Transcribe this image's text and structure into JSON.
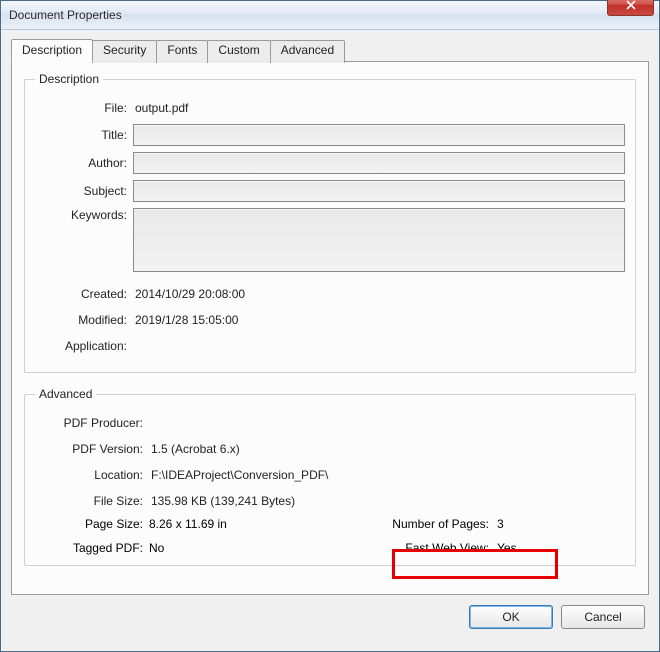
{
  "window": {
    "title": "Document Properties"
  },
  "tabs": {
    "description": "Description",
    "security": "Security",
    "fonts": "Fonts",
    "custom": "Custom",
    "advanced": "Advanced"
  },
  "groups": {
    "description_legend": "Description",
    "advanced_legend": "Advanced"
  },
  "desc": {
    "labels": {
      "file": "File:",
      "title": "Title:",
      "author": "Author:",
      "subject": "Subject:",
      "keywords": "Keywords:",
      "created": "Created:",
      "modified": "Modified:",
      "application": "Application:"
    },
    "values": {
      "file": "output.pdf",
      "title": "",
      "author": "",
      "subject": "",
      "keywords": "",
      "created": "2014/10/29 20:08:00",
      "modified": "2019/1/28 15:05:00",
      "application": ""
    }
  },
  "adv": {
    "labels": {
      "producer": "PDF Producer:",
      "version": "PDF Version:",
      "location": "Location:",
      "filesize": "File Size:",
      "pagesize": "Page Size:",
      "numpages": "Number of Pages:",
      "tagged": "Tagged PDF:",
      "fastweb": "Fast Web View:"
    },
    "values": {
      "producer": "",
      "version": "1.5 (Acrobat 6.x)",
      "location": "F:\\IDEAProject\\Conversion_PDF\\",
      "filesize": "135.98 KB (139,241 Bytes)",
      "pagesize": "8.26 x 11.69 in",
      "numpages": "3",
      "tagged": "No",
      "fastweb": "Yes"
    }
  },
  "buttons": {
    "ok": "OK",
    "cancel": "Cancel"
  }
}
